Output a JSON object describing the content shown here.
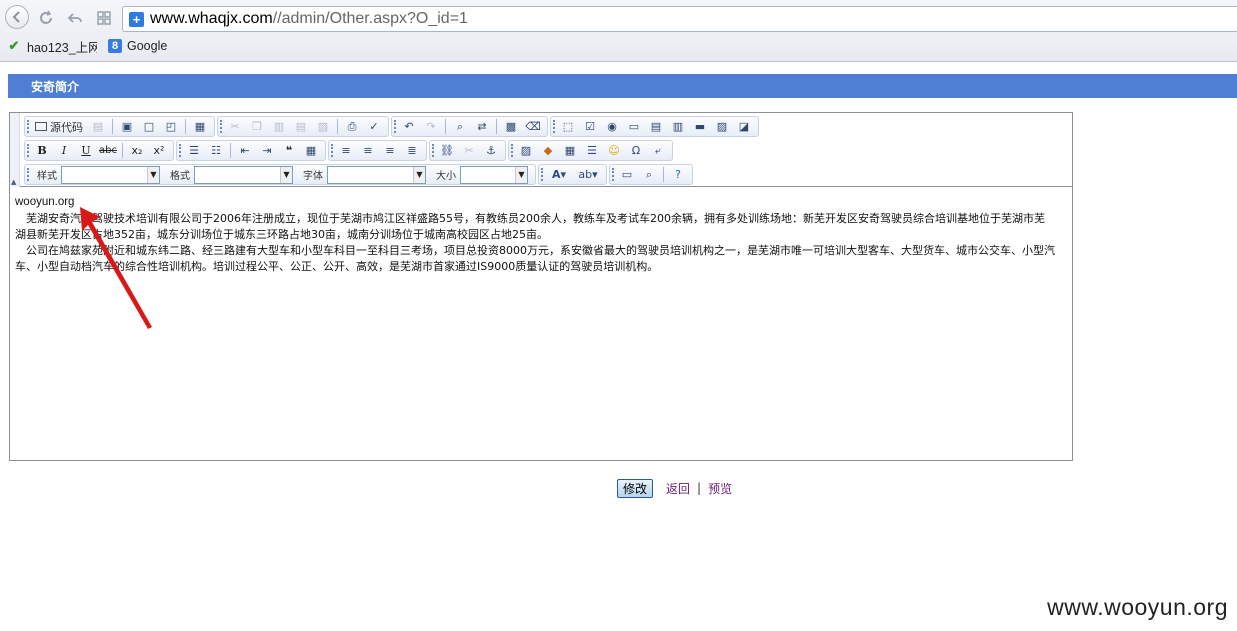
{
  "browser": {
    "address_host": "www.whaqjx.com",
    "address_path": "//admin/Other.aspx?O_id=1",
    "bookmarks": [
      {
        "label": "hao123_上网",
        "icon": "hao123-icon"
      },
      {
        "label": "Google",
        "icon": "google-icon"
      }
    ]
  },
  "page": {
    "section_title": "安奇简介"
  },
  "editor": {
    "toolbar": {
      "source_label": "源代码",
      "style_label": "样式",
      "format_label": "格式",
      "font_label": "字体",
      "size_label": "大小"
    },
    "content": {
      "watermark": "wooyun.org",
      "paragraphs": [
        "芜湖安奇汽车驾驶技术培训有限公司于2006年注册成立，现位于芜湖市鸠江区祥盛路55号，有教练员200余人，教练车及考试车200余辆，拥有多处训练场地：新芜开发区安奇驾驶员综合培训基地位于芜湖市芜湖县新芜开发区占地352亩，城东分训场位于城东三环路占地30亩，城南分训场位于城南高校园区占地25亩。",
        "公司在鸠兹家苑附近和城东纬二路、经三路建有大型车和小型车科目一至科目三考场，项目总投资8000万元，系安徽省最大的驾驶员培训机构之一，是芜湖市唯一可培训大型客车、大型货车、城市公交车、小型汽车、小型自动档汽车的综合性培训机构。培训过程公平、公正、公开、高效，是芜湖市首家通过IS9000质量认证的驾驶员培训机构。"
      ]
    }
  },
  "actions": {
    "modify_label": "修改",
    "back_label": "返回",
    "separator": "|",
    "preview_label": "预览"
  },
  "watermark_text": "www.wooyun.org"
}
